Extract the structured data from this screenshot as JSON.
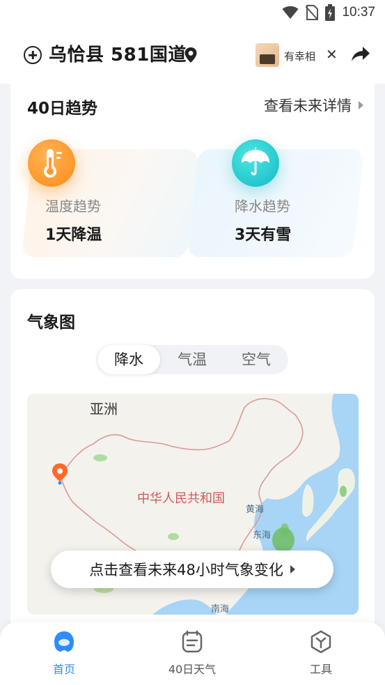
{
  "status_bar": {
    "time": "10:37",
    "icons": [
      "wifi-icon",
      "no-sim-icon",
      "battery-charging-icon"
    ]
  },
  "header": {
    "location": "乌恰县 581国道",
    "ad_text": "有幸相",
    "icons": [
      "add-city-icon",
      "location-pin-icon",
      "close-icon",
      "share-icon"
    ]
  },
  "trend": {
    "title": "40日趋势",
    "more_label": "查看未来详情",
    "tiles": [
      {
        "label": "温度趋势",
        "value": "1天降温",
        "icon": "thermometer-icon",
        "accent": "#ff8a1a"
      },
      {
        "label": "降水趋势",
        "value": "3天有雪",
        "icon": "umbrella-icon",
        "accent": "#13b8c8"
      }
    ]
  },
  "weather_map": {
    "title": "气象图",
    "segments": [
      "降水",
      "气温",
      "空气"
    ],
    "active_segment": "降水",
    "map_labels": {
      "continent": "亚洲",
      "country": "中华人民共和国",
      "sea_yellow": "黄海",
      "sea_east": "东海",
      "sea_south": "南海"
    },
    "cta_label": "点击查看未来48小时气象变化"
  },
  "tabbar": {
    "tabs": [
      {
        "label": "首页",
        "icon": "home-icon",
        "active": true
      },
      {
        "label": "40日天气",
        "icon": "calendar-icon",
        "active": false
      },
      {
        "label": "工具",
        "icon": "tools-icon",
        "active": false
      }
    ],
    "active_color": "#2f8cff"
  }
}
